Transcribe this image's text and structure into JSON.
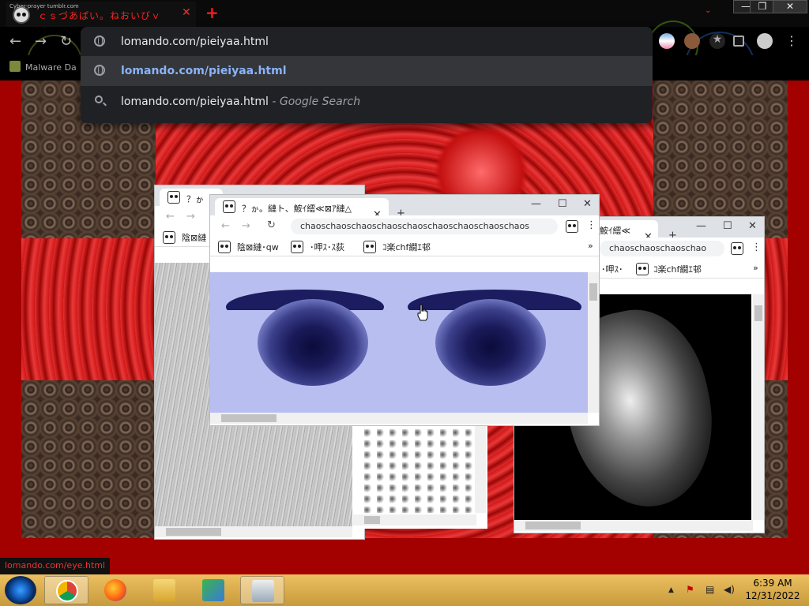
{
  "main_window": {
    "tab": {
      "tiny_caption": "Cyber-prayer tumblr.com",
      "title": "ｃｓづあぱい。ねおいびｖ",
      "close_glyph": "✕",
      "new_tab_glyph": "+"
    },
    "tab_search_glyph": "⌄",
    "window_controls": {
      "minimize": "—",
      "restore": "❐",
      "close": "✕"
    },
    "nav": {
      "back": "←",
      "forward": "→",
      "reload": "↻"
    },
    "bookmarks_bar": {
      "first_item": "Malware Da"
    },
    "omnibox": {
      "input_text": "lomando.com/pieiyaa.html",
      "suggestions": [
        {
          "icon": "globe-icon",
          "text": "lomando.com/pieiyaa.html",
          "subtext": ""
        },
        {
          "icon": "search-icon",
          "text": "lomando.com/pieiyaa.html",
          "subtext": " - Google Search"
        }
      ]
    }
  },
  "popup_window_left": {
    "tab_title": "？ゕ",
    "bookmark": "陰⊠縺"
  },
  "popup_window_front": {
    "tab_title": "？ゕ。縺ト、鮟ｲ繧≪⊠ｱ縺△",
    "tab_close": "✕",
    "new_tab": "+",
    "controls": {
      "minimize": "—",
      "maximize": "☐",
      "close": "✕"
    },
    "url": "chaoschaoschaoschaoschaoschaoschaoschaoschaos",
    "more_menu": "⋮",
    "bookmarks": [
      "陰⊠縺･qw",
      "･呷ｽ･ｽ荻",
      "ｺ楽chf繝ｴ邨"
    ],
    "bookmarks_overflow": "»"
  },
  "popup_window_right": {
    "tab_title": "鮟ｲ繧≪",
    "tab_close": "✕",
    "new_tab": "+",
    "controls": {
      "minimize": "—",
      "maximize": "☐",
      "close": "✕"
    },
    "url": "chaoschaoschaoschao",
    "more_menu": "⋮",
    "bookmarks": [
      "･呷ｽ･",
      "ｺ楽chf繝ｴ邨"
    ],
    "bookmarks_overflow": "»"
  },
  "status_bubble": "lomando.com/eye.html",
  "taskbar": {
    "apps": [
      "start-button",
      "chrome",
      "firefox",
      "file-explorer",
      "network-app",
      "image-viewer"
    ],
    "tray_expand": "▲",
    "clock": {
      "time": "6:39 AM",
      "date": "12/31/2022"
    }
  },
  "colors": {
    "page_background": "#a30000",
    "omnibox_background": "#202124",
    "link_blue": "#8ab4f8",
    "taskbar": "#dcae4c",
    "tab_title_red": "#ff2020"
  }
}
